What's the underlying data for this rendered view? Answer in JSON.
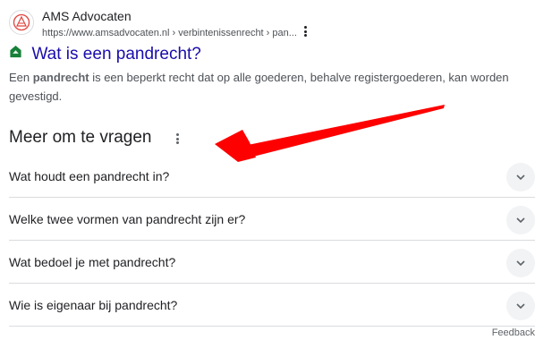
{
  "result": {
    "site_name": "AMS Advocaten",
    "site_url": "https://www.amsadvocaten.nl › verbintenissenrecht › pan...",
    "title": "Wat is een pandrecht?",
    "snippet_before": "Een ",
    "snippet_bold": "pandrecht",
    "snippet_after": " is een beperkt recht dat op alle goederen, behalve registergoederen, kan worden gevestigd."
  },
  "people_also_ask": {
    "heading": "Meer om te vragen",
    "questions": [
      "Wat houdt een pandrecht in?",
      "Welke twee vormen van pandrecht zijn er?",
      "Wat bedoel je met pandrecht?",
      "Wie is eigenaar bij pandrecht?"
    ],
    "feedback_label": "Feedback"
  },
  "annotation": {
    "arrow_color": "#ff0000"
  },
  "colors": {
    "link": "#1a0dab",
    "text": "#202124",
    "muted": "#4d5156",
    "divider": "#dadce0",
    "chevron_bg": "#f1f3f4",
    "favicon_accent": "#e0443e",
    "title_icon": "#188038"
  },
  "icons": {
    "favicon": "ams-logo-icon",
    "title_icon": "green-shield-icon",
    "chevron": "chevron-down-icon",
    "menu": "more-vert-icon"
  }
}
